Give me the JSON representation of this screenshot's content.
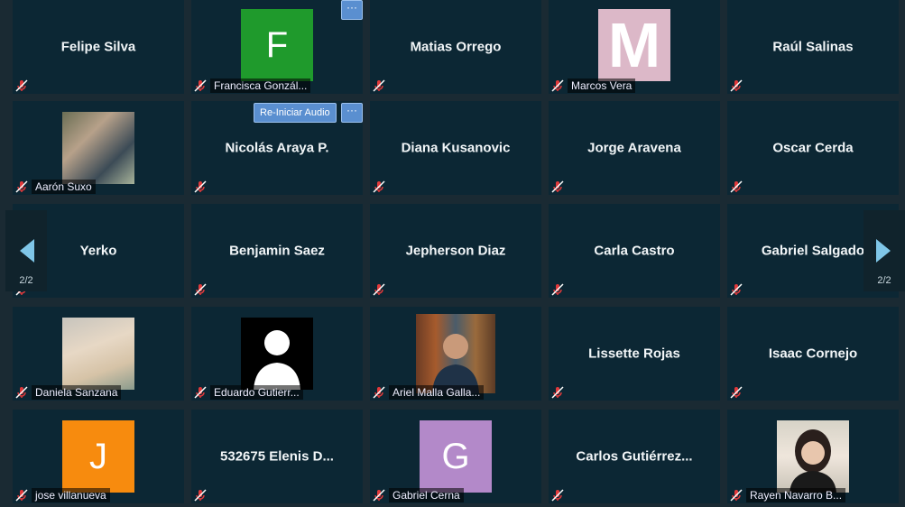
{
  "pagination": {
    "left_page": "2/2",
    "right_page": "2/2"
  },
  "buttons": {
    "more_label": "···",
    "restart_audio_label": "Re-Iniciar Audio"
  },
  "colors": {
    "tile_bg": "#0c2734",
    "mute": "#e0393b",
    "button": "#5a8fd0"
  },
  "participants": [
    {
      "center": "Felipe Silva"
    },
    {
      "label": "Francisca Gonzál...",
      "avatar_letter": "F",
      "avatar_color": "#1f9a2c"
    },
    {
      "center": "Matias Orrego"
    },
    {
      "label": "Marcos Vera",
      "avatar_letter": "M",
      "avatar_color": "#dcb8c8"
    },
    {
      "center": "Raúl Salinas"
    },
    {
      "label": "Aarón Suxo",
      "photo": "group-selfie"
    },
    {
      "center": "Nicolás Araya P."
    },
    {
      "center": "Diana Kusanovic"
    },
    {
      "center": "Jorge Aravena"
    },
    {
      "center": "Oscar Cerda"
    },
    {
      "center": "Yerko"
    },
    {
      "center": "Benjamin Saez"
    },
    {
      "center": "Jepherson Diaz"
    },
    {
      "center": "Carla Castro"
    },
    {
      "center": "Gabriel Salgado"
    },
    {
      "label": "Daniela Sanzana",
      "photo": "hat-portrait"
    },
    {
      "label": "Eduardo Gutierr...",
      "photo": "silhouette"
    },
    {
      "label": "Ariel Malla Galla...",
      "photo": "bookshelf-portrait"
    },
    {
      "center": "Lissette Rojas"
    },
    {
      "center": "Isaac Cornejo"
    },
    {
      "label": "jose villanueva",
      "avatar_letter": "J",
      "avatar_color": "#f78b0e"
    },
    {
      "center": "532675 Elenis D..."
    },
    {
      "label": "Gabriel Cerna",
      "avatar_letter": "G",
      "avatar_color": "#b389c9"
    },
    {
      "center": "Carlos  Gutiérrez..."
    },
    {
      "label": "Rayen Navarro B...",
      "photo": "woman-portrait"
    }
  ]
}
